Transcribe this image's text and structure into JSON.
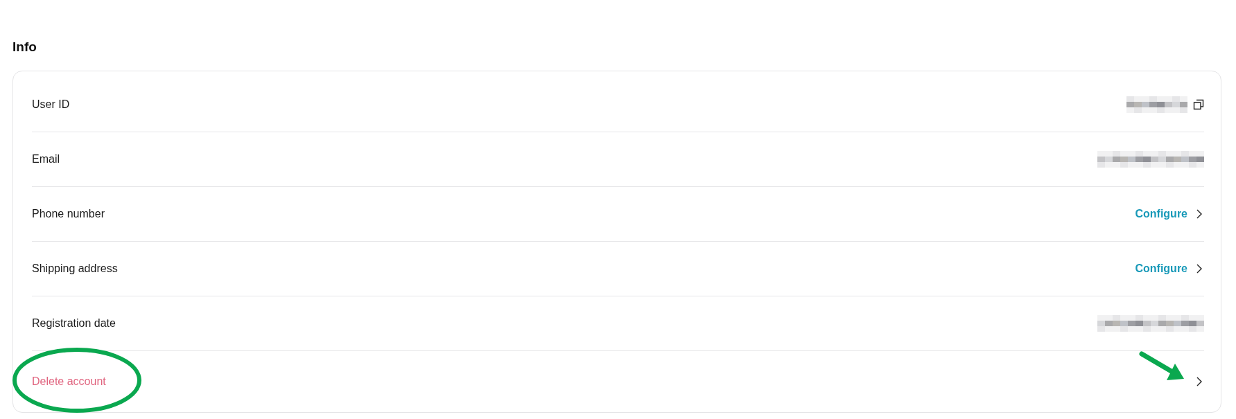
{
  "section": {
    "title": "Info"
  },
  "rows": [
    {
      "label": "User ID",
      "kind": "hidden",
      "copyable": true
    },
    {
      "label": "Email",
      "kind": "hidden",
      "copyable": false
    },
    {
      "label": "Phone number",
      "kind": "link",
      "action": "Configure"
    },
    {
      "label": "Shipping address",
      "kind": "link",
      "action": "Configure"
    },
    {
      "label": "Registration date",
      "kind": "hidden",
      "copyable": false
    },
    {
      "label": "Delete account",
      "kind": "danger"
    }
  ]
}
